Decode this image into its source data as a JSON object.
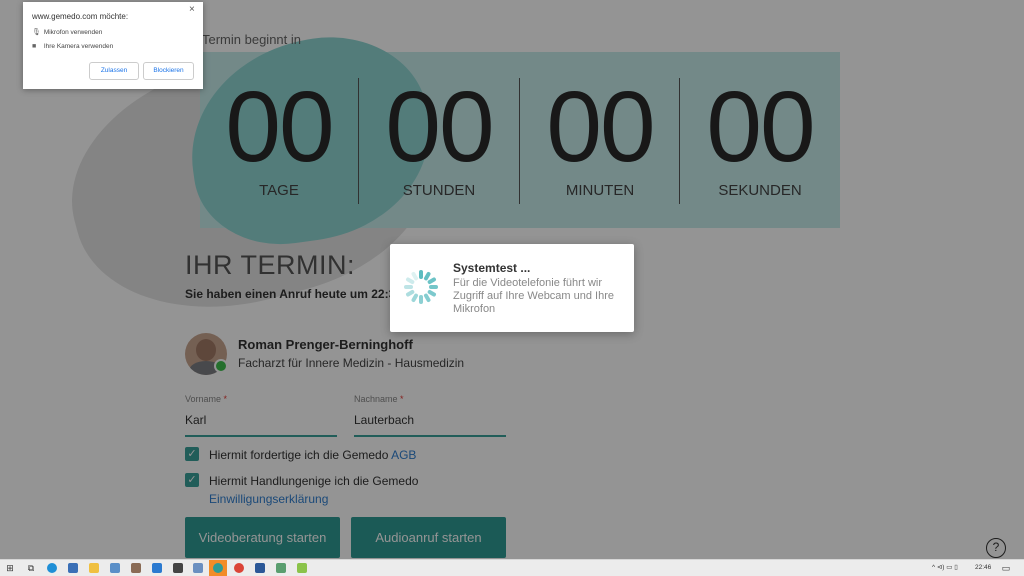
{
  "countdown": {
    "title": "Termin beginnt in",
    "units": [
      {
        "value": "00",
        "label": "TAGE"
      },
      {
        "value": "00",
        "label": "STUNDEN"
      },
      {
        "value": "00",
        "label": "MINUTEN"
      },
      {
        "value": "00",
        "label": "SEKUNDEN"
      }
    ]
  },
  "appointment": {
    "heading": "IHR TERMIN:",
    "subtitle": "Sie haben einen Anruf heute um 22:3"
  },
  "doctor": {
    "name": "Roman Prenger-Berninghoff",
    "title": "Facharzt für Innere Medizin - Hausmedizin"
  },
  "form": {
    "first_name_label": "Vorname",
    "first_name_value": "Karl",
    "last_name_label": "Nachname",
    "last_name_value": "Lauterbach",
    "required_mark": "*",
    "check1_text": "Hiermit fordertige ich die Gemedo",
    "check1_link": "AGB",
    "check2_text": "Hiermit Handlungenige ich die Gemedo",
    "check2_link": "Einwilligungserklärung",
    "check_mark": "✓"
  },
  "buttons": {
    "video": "Videoberatung starten",
    "audio": "Audioanruf starten",
    "help": "?"
  },
  "modal": {
    "title": "Systemtest ...",
    "text": "Für die Videotelefonie führt wir Zugriff auf Ihre Webcam und Ihre Mikrofon"
  },
  "permission": {
    "title": "www.gemedo.com möchte:",
    "close": "×",
    "mic": "Mikrofon verwenden",
    "camera": "Ihre Kamera verwenden",
    "allow": "Zulassen",
    "block": "Blockieren"
  },
  "taskbar": {
    "time": "22:46",
    "icons": [
      "windows-icon",
      "task-view-icon",
      "edge-icon",
      "people-icon",
      "explorer-icon",
      "notepad-icon",
      "tools-icon",
      "store-icon",
      "mail-icon",
      "terminal-icon",
      "app-icon",
      "gemedo-icon",
      "chrome-icon",
      "word-icon",
      "download-icon",
      "paint-icon"
    ],
    "tray": "^  ⊲)  ▭  ▯"
  }
}
